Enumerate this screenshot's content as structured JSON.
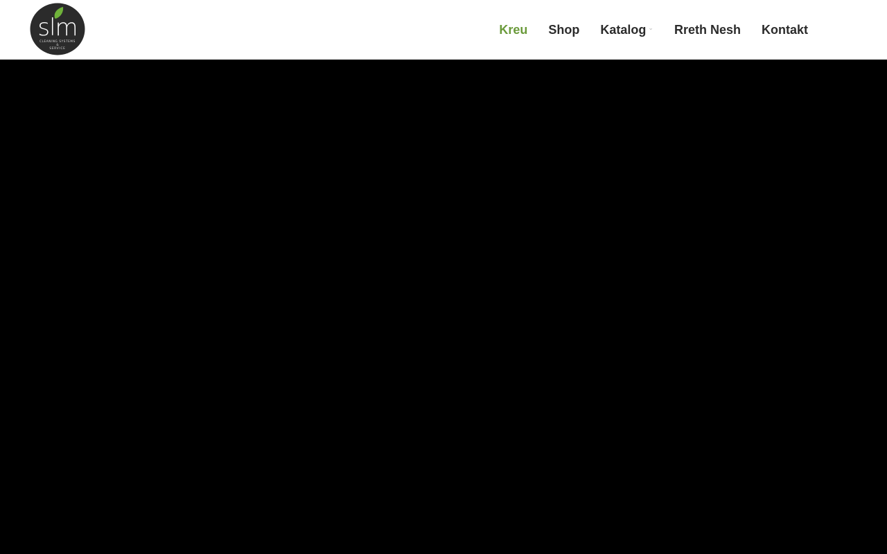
{
  "brand": {
    "logo_text": "slm",
    "logo_tagline": "CLEANING SYSTEMS & SERVICE",
    "logo_bg_color": "#2b2b2b",
    "leaf_color": "#6fb23a"
  },
  "nav": {
    "items": [
      {
        "label": "Kreu",
        "active": true
      },
      {
        "label": "Shop"
      },
      {
        "label": "Katalog",
        "has_dropdown": true
      },
      {
        "label": "Rreth Nesh"
      },
      {
        "label": "Kontakt"
      }
    ],
    "active_color": "#6a9a3a",
    "text_color": "#2b2b2b"
  },
  "hero": {
    "background": "#000000"
  }
}
